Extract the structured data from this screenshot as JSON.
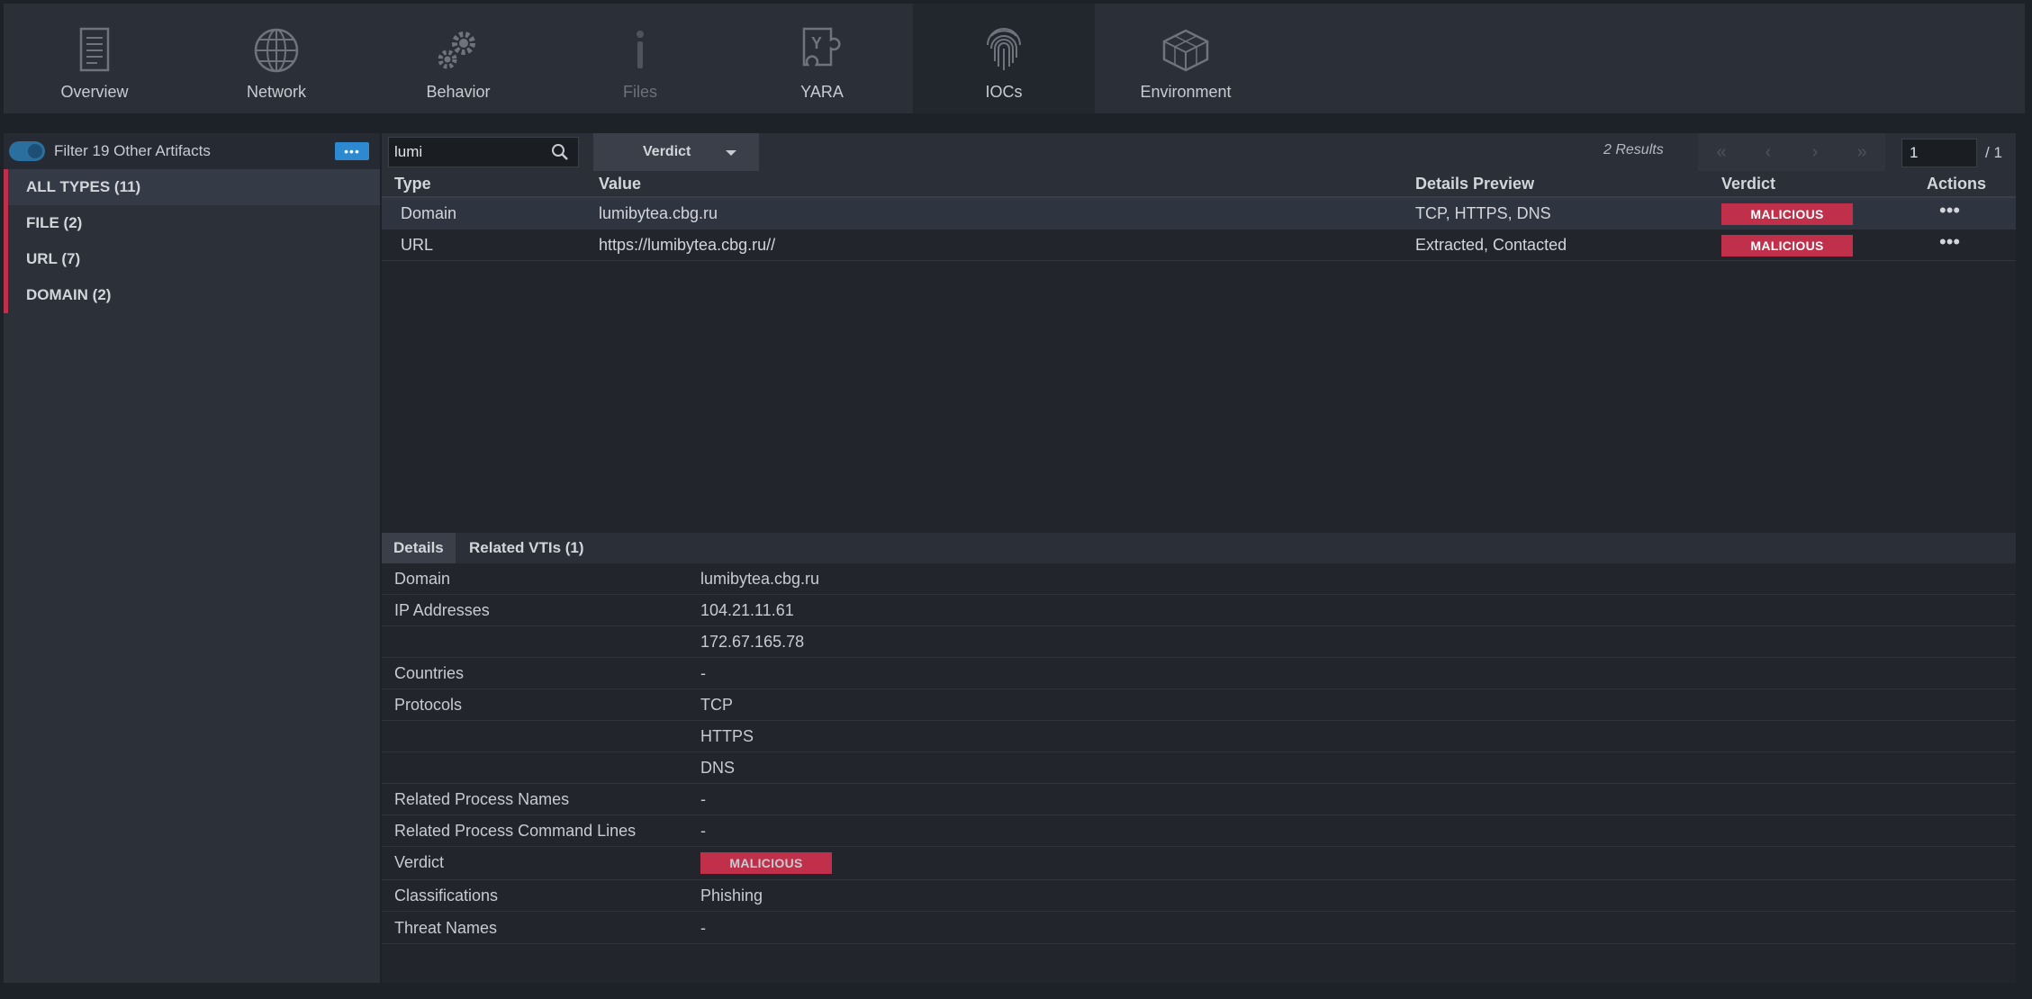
{
  "tabs": [
    {
      "label": "Overview",
      "icon": "document-icon",
      "state": "normal"
    },
    {
      "label": "Network",
      "icon": "globe-icon",
      "state": "normal"
    },
    {
      "label": "Behavior",
      "icon": "gears-icon",
      "state": "normal"
    },
    {
      "label": "Files",
      "icon": "info-icon",
      "state": "disabled"
    },
    {
      "label": "YARA",
      "icon": "yara-icon",
      "state": "normal"
    },
    {
      "label": "IOCs",
      "icon": "fingerprint-icon",
      "state": "active"
    },
    {
      "label": "Environment",
      "icon": "cube-icon",
      "state": "normal"
    }
  ],
  "sidebar": {
    "filter_label": "Filter 19 Other Artifacts",
    "more_label": "•••",
    "types": [
      {
        "label": "ALL TYPES (11)",
        "active": true
      },
      {
        "label": "FILE (2)",
        "active": false
      },
      {
        "label": "URL (7)",
        "active": false
      },
      {
        "label": "DOMAIN (2)",
        "active": false
      }
    ]
  },
  "toolbar": {
    "search_value": "lumi",
    "verdict_label": "Verdict",
    "results_text": "2 Results",
    "pager": {
      "first": "«",
      "prev": "‹",
      "next": "›",
      "last": "»"
    },
    "page_value": "1",
    "page_total": "/ 1"
  },
  "table": {
    "headers": {
      "type": "Type",
      "value": "Value",
      "details": "Details Preview",
      "verdict": "Verdict",
      "actions": "Actions"
    },
    "rows": [
      {
        "type": "Domain",
        "value": "lumibytea.cbg.ru",
        "details": "TCP, HTTPS, DNS",
        "verdict": "MALICIOUS",
        "actions": "•••"
      },
      {
        "type": "URL",
        "value": "https://lumibytea.cbg.ru//",
        "details": "Extracted, Contacted",
        "verdict": "MALICIOUS",
        "actions": "•••"
      }
    ]
  },
  "details": {
    "tabs": [
      "Details",
      "Related VTIs (1)"
    ],
    "rows": [
      {
        "key": "Domain",
        "value": "lumibytea.cbg.ru"
      },
      {
        "key": "IP Addresses",
        "value": "104.21.11.61"
      },
      {
        "key": "",
        "value": "172.67.165.78"
      },
      {
        "key": "Countries",
        "value": "-"
      },
      {
        "key": "Protocols",
        "value": "TCP"
      },
      {
        "key": "",
        "value": "HTTPS"
      },
      {
        "key": "",
        "value": "DNS"
      },
      {
        "key": "Related Process Names",
        "value": "-"
      },
      {
        "key": "Related Process Command Lines",
        "value": "-"
      },
      {
        "key": "Verdict",
        "value": "MALICIOUS"
      },
      {
        "key": "Classifications",
        "value": "Phishing"
      },
      {
        "key": "Threat Names",
        "value": "-"
      }
    ]
  },
  "colors": {
    "accent": "#2e8ad0",
    "malicious": "#c0304a",
    "type_marker": "#c0304a"
  }
}
